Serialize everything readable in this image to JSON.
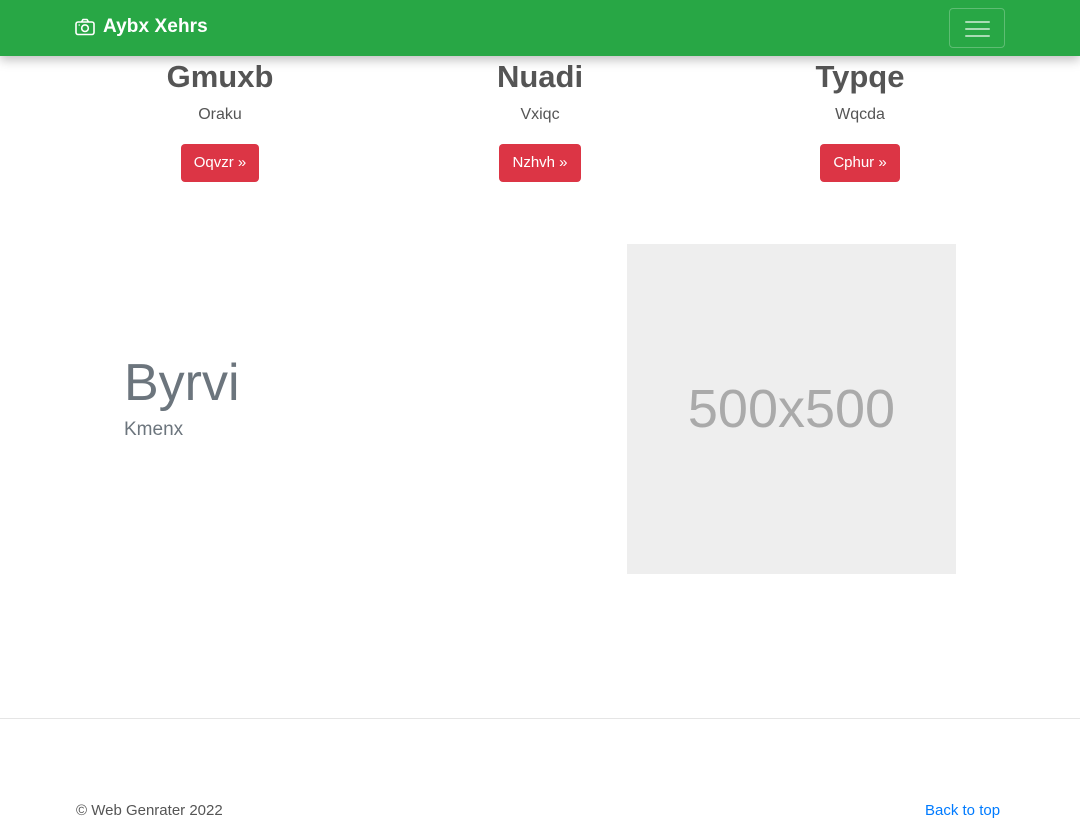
{
  "navbar": {
    "brand": "Aybx Xehrs",
    "brand_icon": "camera-icon",
    "toggler_icon": "hamburger-icon",
    "background": "#28a745"
  },
  "features": [
    {
      "title": "Gmuxb",
      "text": "Oraku",
      "button": "Oqvzr »"
    },
    {
      "title": "Nuadi",
      "text": "Vxiqc",
      "button": "Nzhvh »"
    },
    {
      "title": "Typqe",
      "text": "Wqcda",
      "button": "Cphur »"
    }
  ],
  "hero": {
    "title": "Byrvi",
    "subtitle": "Kmenx",
    "image_label": "500x500"
  },
  "footer": {
    "copyright": "© Web Genrater 2022",
    "back_to_top": "Back to top"
  },
  "colors": {
    "button": "#dc3545",
    "link": "#007bff"
  }
}
